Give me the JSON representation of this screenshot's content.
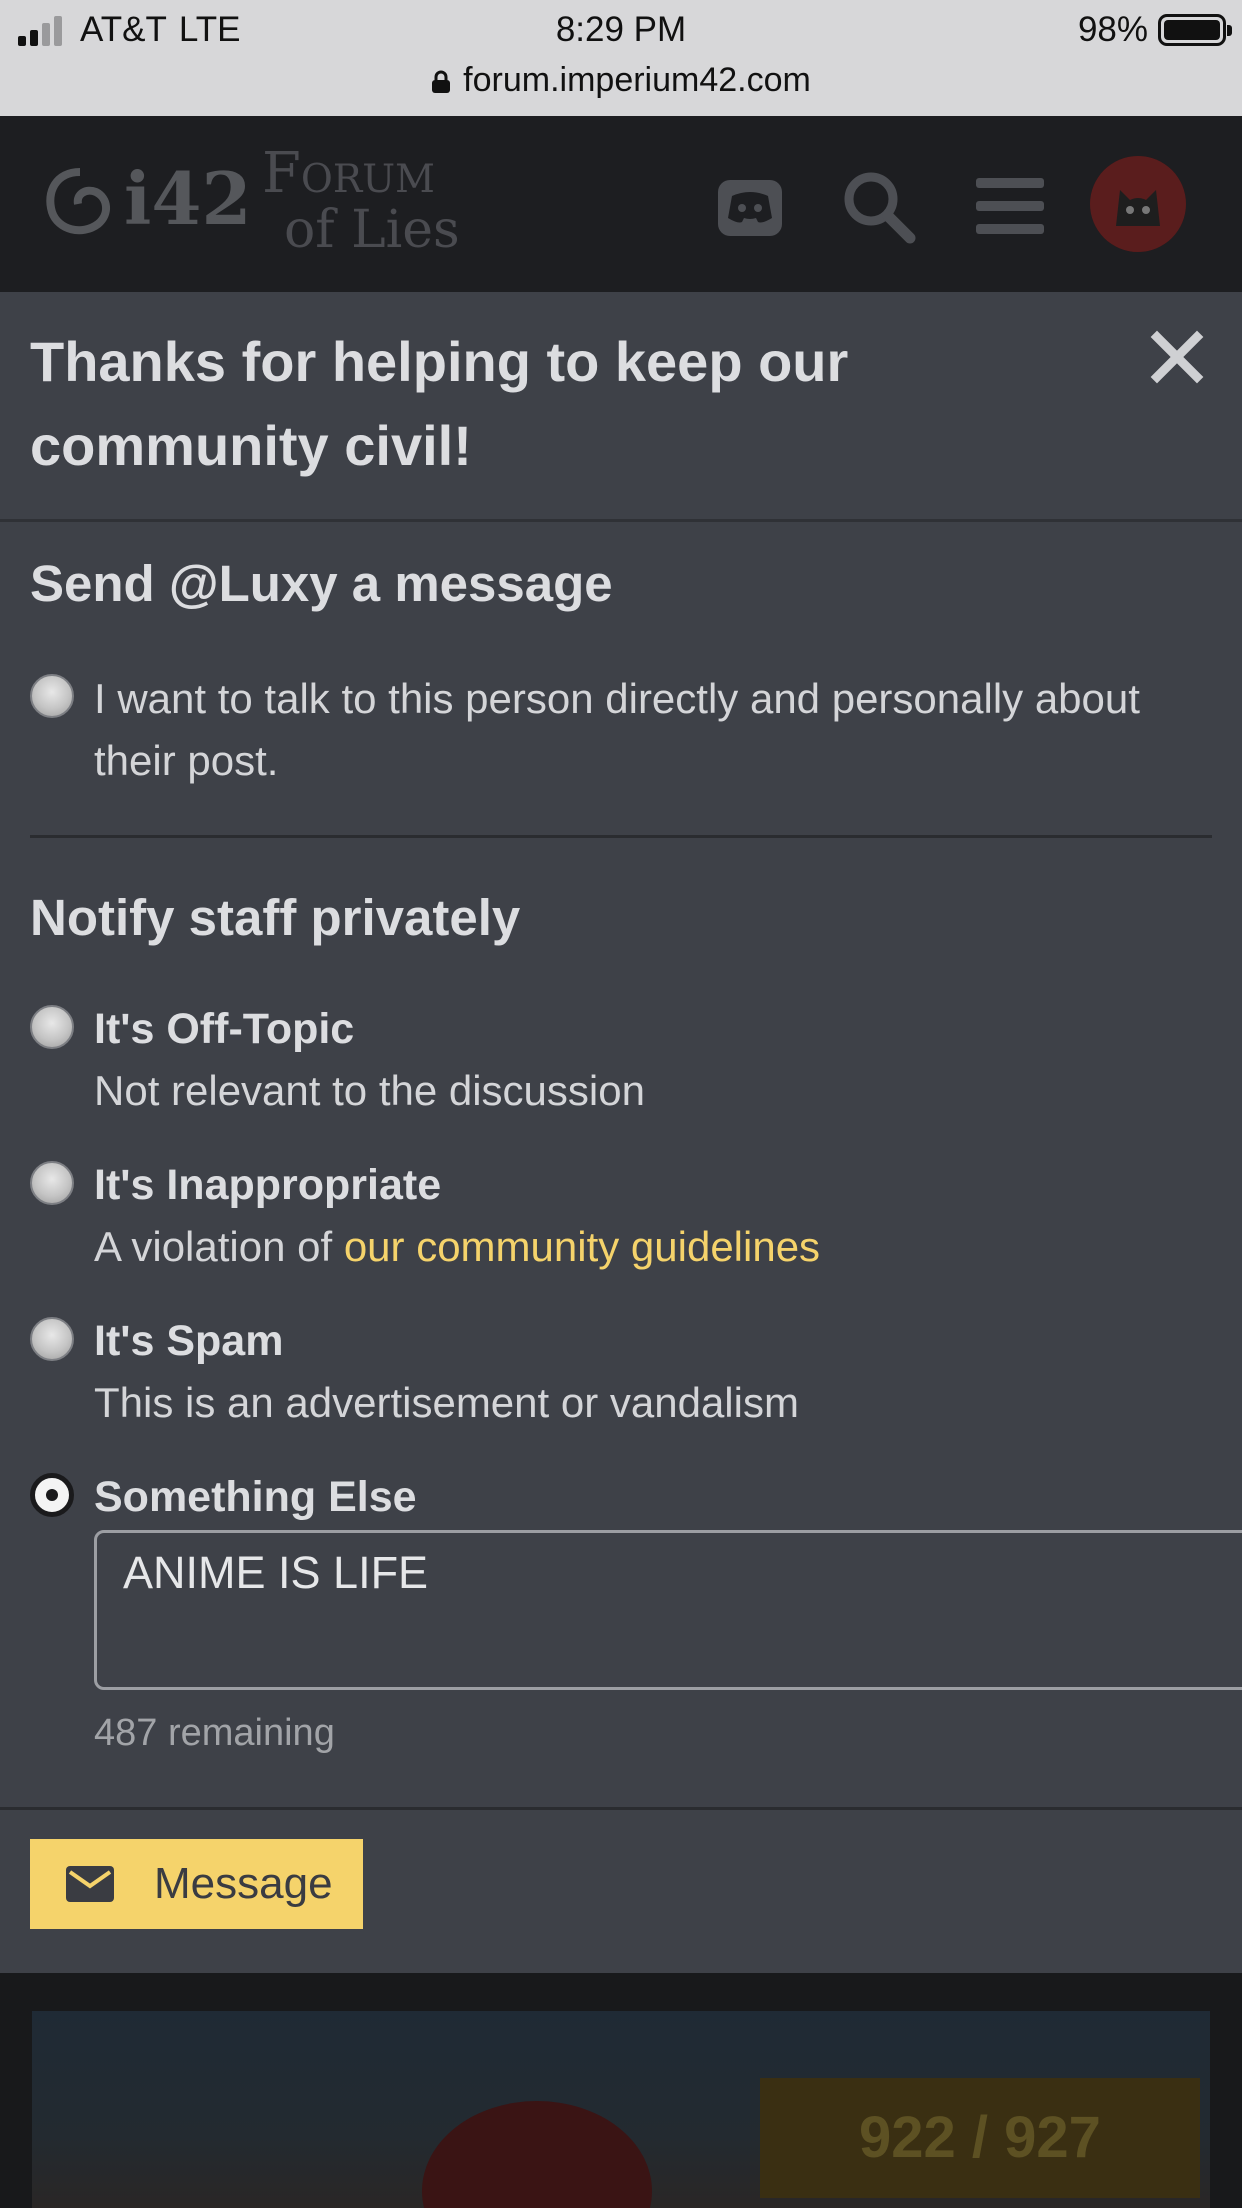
{
  "status_bar": {
    "carrier": "AT&T",
    "network": "LTE",
    "time": "8:29 PM",
    "battery": "98%",
    "url": "forum.imperium42.com"
  },
  "forum_header": {
    "logo_i42": "i42",
    "logo_forum_line1": "Forum",
    "logo_forum_line2": "of Lies"
  },
  "modal": {
    "title": "Thanks for helping to keep our community civil!",
    "message_section": {
      "heading": "Send @Luxy a message",
      "option_text": "I want to talk to this person directly and personally about their post."
    },
    "staff_section": {
      "heading": "Notify staff privately",
      "options": [
        {
          "title": "It's Off-Topic",
          "desc": "Not relevant to the discussion",
          "checked": false
        },
        {
          "title": "It's Inappropriate",
          "desc_prefix": "A violation of ",
          "link": "our community guidelines",
          "checked": false
        },
        {
          "title": "It's Spam",
          "desc": "This is an advertisement or vandalism",
          "checked": false
        },
        {
          "title": "Something Else",
          "checked": true
        }
      ],
      "textarea_value": "ANIME IS LIFE",
      "remaining": "487 remaining"
    },
    "submit_label": "Message"
  },
  "background_post": {
    "progress_text": "922 / 927"
  },
  "colors": {
    "modal_bg": "#3e4148",
    "accent": "#f5d36b",
    "text": "#dcdde0"
  }
}
